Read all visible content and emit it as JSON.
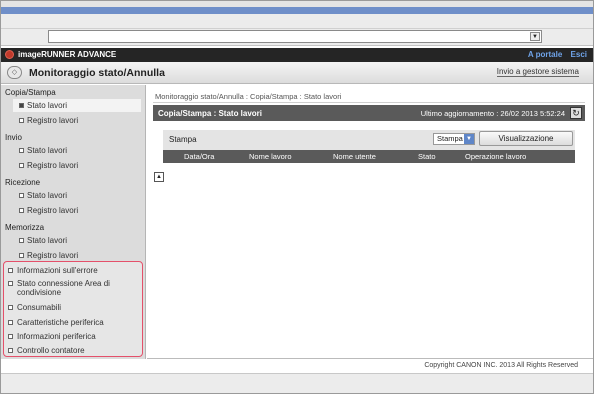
{
  "app": {
    "brand": "imageRUNNER ADVANCE",
    "portal_link": "A portale",
    "exit_link": "Esci"
  },
  "title": {
    "text": "Monitoraggio stato/Annulla",
    "send_link": "Invio a gestore sistema"
  },
  "sidebar": {
    "groups": [
      {
        "heading": "Copia/Stampa",
        "items": [
          "Stato lavori",
          "Registro lavori"
        ]
      },
      {
        "heading": "Invio",
        "items": [
          "Stato lavori",
          "Registro lavori"
        ]
      },
      {
        "heading": "Ricezione",
        "items": [
          "Stato lavori",
          "Registro lavori"
        ]
      },
      {
        "heading": "Memorizza",
        "items": [
          "Stato lavori",
          "Registro lavori"
        ]
      }
    ],
    "extra_items": [
      "Informazioni sull'errore",
      "Stato connessione Area di condivisione",
      "Consumabili",
      "Caratteristiche periferica",
      "Informazioni periferica",
      "Controllo contatore"
    ],
    "highlight_color": "#e4506a"
  },
  "main": {
    "breadcrumb": "Monitoraggio stato/Annulla : Copia/Stampa : Stato lavori",
    "section_title": "Copia/Stampa : Stato lavori",
    "last_update": "Ultimo aggiornamento : 26/02 2013 5:52:24",
    "panel_label": "Stampa",
    "select_value": "Stampa",
    "view_button": "Visualizzazione",
    "columns": [
      "Data/Ora",
      "Nome lavoro",
      "Nome utente",
      "Stato",
      "Operazione lavoro"
    ]
  },
  "footer": {
    "copyright": "Copyright CANON INC. 2013 All Rights Reserved"
  }
}
